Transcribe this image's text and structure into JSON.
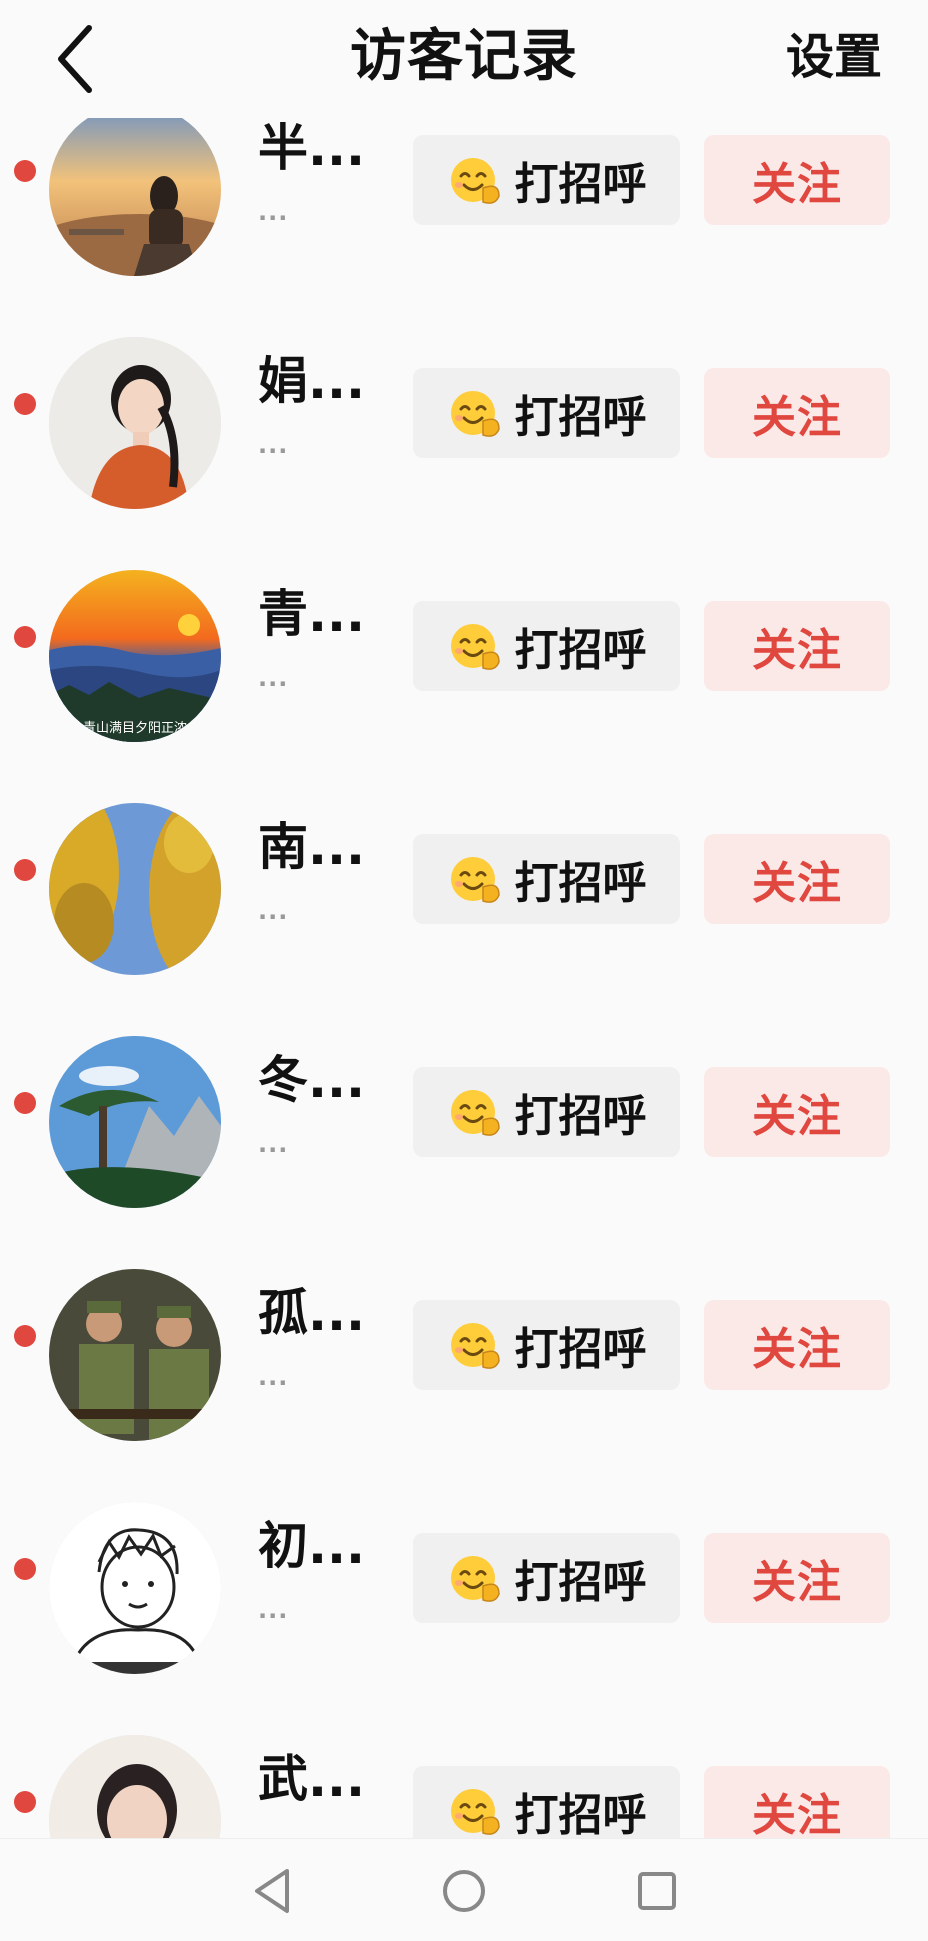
{
  "header": {
    "title": "访客记录",
    "settings_label": "设置"
  },
  "visitors": [
    {
      "name": "半...",
      "sub": "...",
      "greet_label": "打招呼",
      "follow_label": "关注",
      "avatar": "sunset-desert-woman"
    },
    {
      "name": "娟...",
      "sub": "...",
      "greet_label": "打招呼",
      "follow_label": "关注",
      "avatar": "smiling-woman-braid"
    },
    {
      "name": "青...",
      "sub": "...",
      "greet_label": "打招呼",
      "follow_label": "关注",
      "avatar": "sunset-mountains",
      "avatar_caption": "青山满目夕阳正浓"
    },
    {
      "name": "南...",
      "sub": "...",
      "greet_label": "打招呼",
      "follow_label": "关注",
      "avatar": "ginkgo-trees-sky"
    },
    {
      "name": "冬...",
      "sub": "...",
      "greet_label": "打招呼",
      "follow_label": "关注",
      "avatar": "pine-mountain"
    },
    {
      "name": "孤...",
      "sub": "...",
      "greet_label": "打招呼",
      "follow_label": "关注",
      "avatar": "soldiers"
    },
    {
      "name": "初...",
      "sub": "...",
      "greet_label": "打招呼",
      "follow_label": "关注",
      "avatar": "cartoon-boy-sketch"
    },
    {
      "name": "武...",
      "sub": "...",
      "greet_label": "打招呼",
      "follow_label": "关注",
      "avatar": "woman-portrait"
    }
  ],
  "colors": {
    "accent": "#e0473f",
    "follow_bg": "#fbe9e8",
    "greet_bg": "#f0f0f0",
    "unread_dot": "#e0473f"
  },
  "icons": {
    "back": "chevron-left-icon",
    "greet": "smiling-face-emoji-icon",
    "nav": [
      "back-triangle-icon",
      "home-circle-icon",
      "recent-square-icon"
    ]
  }
}
